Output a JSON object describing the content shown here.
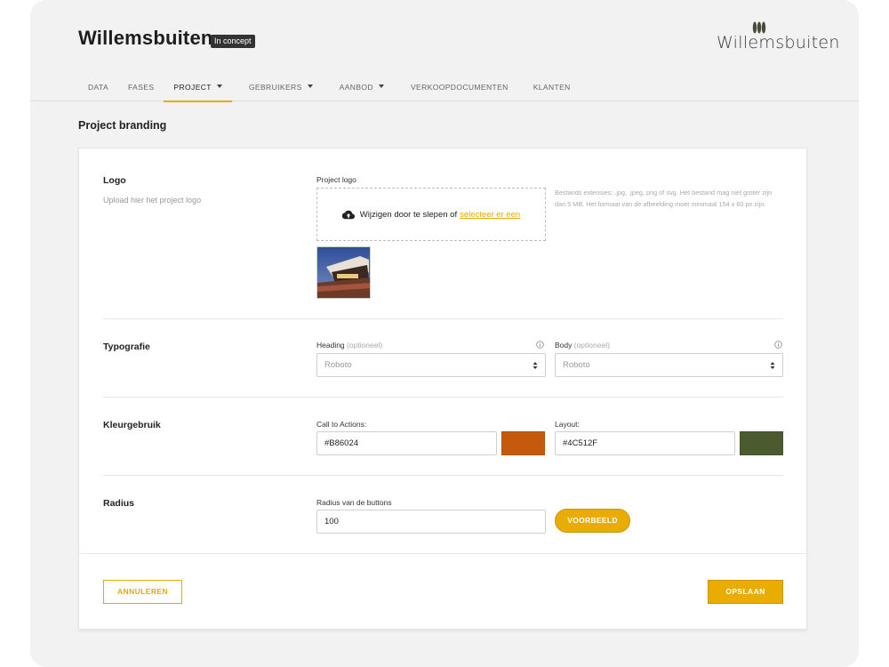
{
  "header": {
    "title": "Willemsbuiten",
    "status_badge": "In concept",
    "brand_logo_text": "Willemsbuiten"
  },
  "nav": {
    "tabs": [
      {
        "label": "DATA",
        "has_dropdown": false,
        "active": false
      },
      {
        "label": "FASES",
        "has_dropdown": false,
        "active": false
      },
      {
        "label": "PROJECT",
        "has_dropdown": true,
        "active": true
      },
      {
        "label": "GEBRUIKERS",
        "has_dropdown": true,
        "active": false
      },
      {
        "label": "AANBOD",
        "has_dropdown": true,
        "active": false
      },
      {
        "label": "VERKOOPDOCUMENTEN",
        "has_dropdown": false,
        "active": false
      },
      {
        "label": "KLANTEN",
        "has_dropdown": false,
        "active": false
      }
    ]
  },
  "page": {
    "section_title": "Project branding"
  },
  "logo_section": {
    "title": "Logo",
    "subtitle": "Upload hier het project logo",
    "field_label": "Project logo",
    "dropzone_text": "Wijzigen door te slepen of",
    "dropzone_link": "selecteer er een",
    "hint": "Bestands extensies: .jpg, .jpeg, png of svg. Het bestand mag niet groter zijn dan 5 MB. Het formaat van de afbeelding moet minimaal 154 x 60 px zijn.",
    "icon": "cloud-upload-icon"
  },
  "typography_section": {
    "title": "Typografie",
    "heading_label": "Heading",
    "body_label": "Body",
    "optional_text": "(optioneel)",
    "heading_value": "Roboto",
    "body_value": "Roboto"
  },
  "color_section": {
    "title": "Kleurgebruik",
    "cta_label": "Call to Actions:",
    "cta_value": "#B86024",
    "cta_swatch": "#C65A0C",
    "layout_label": "Layout:",
    "layout_value": "#4C512F",
    "layout_swatch": "#4C5A2F"
  },
  "radius_section": {
    "title": "Radius",
    "field_label": "Radius van de buttons",
    "value": "100",
    "preview_button": "VOORBEELD"
  },
  "footer": {
    "cancel": "ANNULEREN",
    "save": "OPSLAAN"
  },
  "colors": {
    "accent": "#E8AD00",
    "background": "#F2F2F2"
  }
}
